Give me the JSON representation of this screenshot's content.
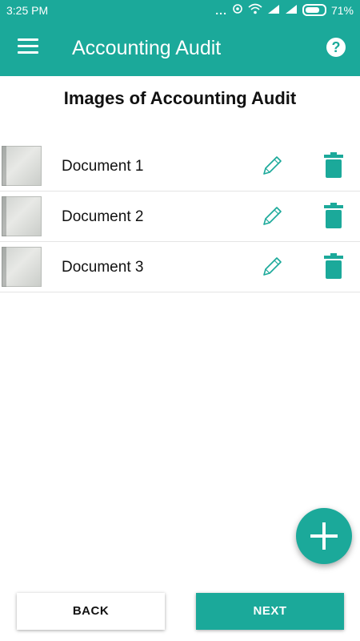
{
  "status_bar": {
    "time": "3:25 PM",
    "dots": "...",
    "battery_percent": "71%"
  },
  "app_bar": {
    "title": "Accounting Audit",
    "help_glyph": "?",
    "menu_icon": "hamburger-menu-icon",
    "help_icon": "help-circle-icon"
  },
  "page": {
    "heading": "Images of Accounting Audit"
  },
  "documents": [
    {
      "label": "Document 1"
    },
    {
      "label": "Document 2"
    },
    {
      "label": "Document 3"
    }
  ],
  "actions": {
    "back_label": "BACK",
    "next_label": "NEXT",
    "add_icon": "plus-icon"
  },
  "colors": {
    "primary": "#1ba99a",
    "background": "#ffffff",
    "text": "#111111",
    "divider": "#e4e4e4"
  }
}
